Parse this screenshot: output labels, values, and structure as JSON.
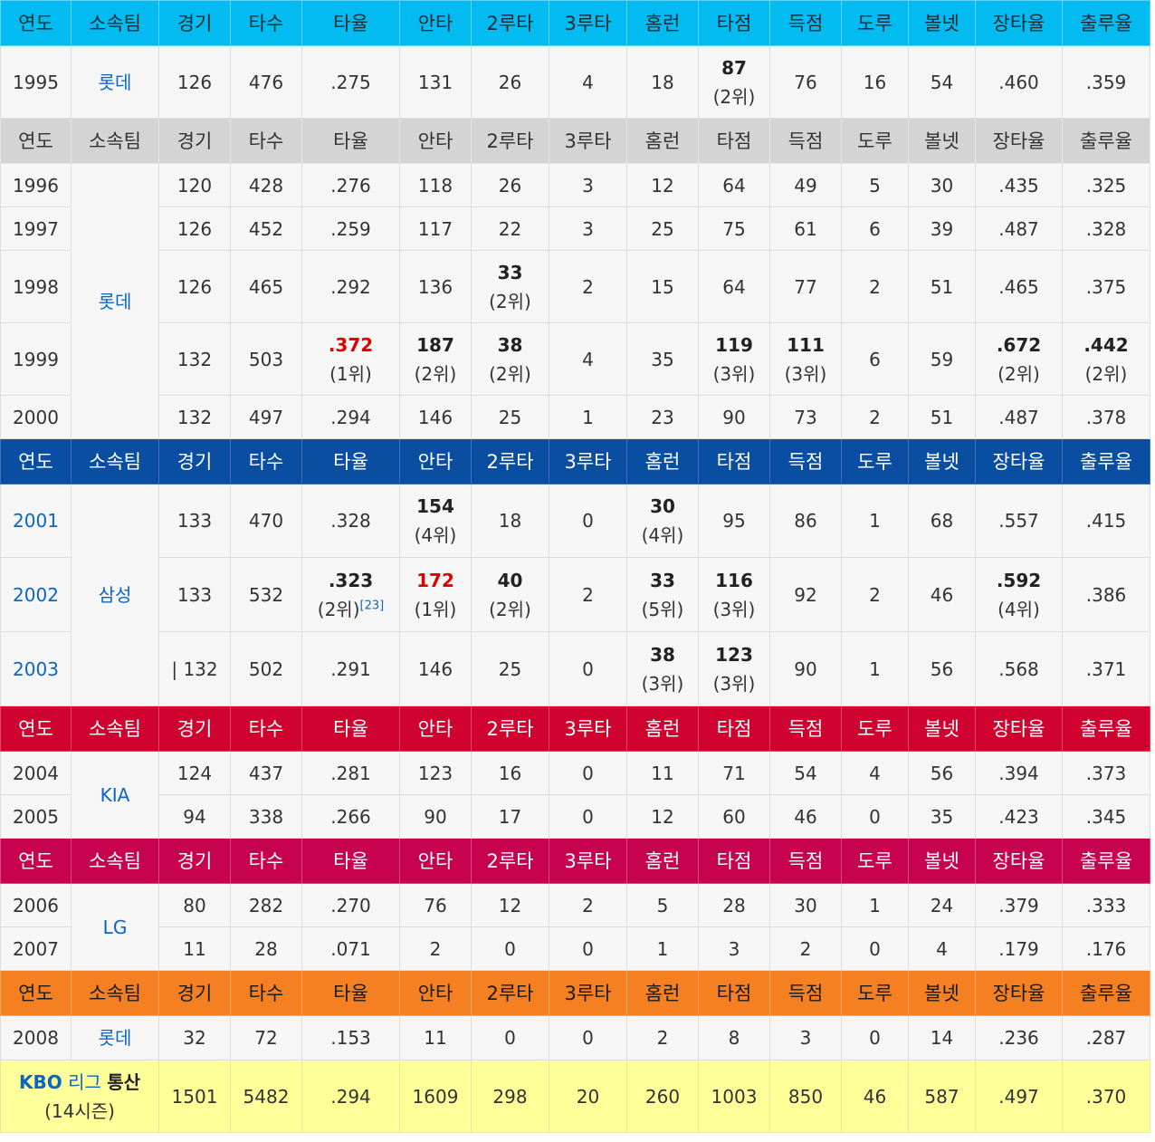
{
  "columns": [
    "연도",
    "소속팀",
    "경기",
    "타수",
    "타율",
    "안타",
    "2루타",
    "3루타",
    "홈런",
    "타점",
    "득점",
    "도루",
    "볼넷",
    "장타율",
    "출루율"
  ],
  "rank": {
    "r1": "(1위)",
    "r2": "(2위)",
    "r3": "(3위)",
    "r4": "(4위)",
    "r5": "(5위)"
  },
  "teams": {
    "lotte": "롯데",
    "samsung": "삼성",
    "kia": "KIA",
    "lg": "LG"
  },
  "header_colors": {
    "lotte_1995": "#02bbf1",
    "lotte_1996": "#d4d4d4",
    "samsung": "#0a4ea2",
    "kia": "#d0022f",
    "lg": "#c7024f",
    "lotte_2008": "#f48022",
    "total": "#ffff99",
    "league_leader": "#e00000"
  },
  "rows": {
    "y1995": {
      "year": "1995",
      "g": "126",
      "ab": "476",
      "avg": ".275",
      "h": "131",
      "d": "26",
      "t": "4",
      "hr": "18",
      "rbi": "87",
      "r": "76",
      "sb": "16",
      "bb": "54",
      "slg": ".460",
      "obp": ".359"
    },
    "y1996": {
      "year": "1996",
      "g": "120",
      "ab": "428",
      "avg": ".276",
      "h": "118",
      "d": "26",
      "t": "3",
      "hr": "12",
      "rbi": "64",
      "r": "49",
      "sb": "5",
      "bb": "30",
      "slg": ".435",
      "obp": ".325"
    },
    "y1997": {
      "year": "1997",
      "g": "126",
      "ab": "452",
      "avg": ".259",
      "h": "117",
      "d": "22",
      "t": "3",
      "hr": "25",
      "rbi": "75",
      "r": "61",
      "sb": "6",
      "bb": "39",
      "slg": ".487",
      "obp": ".328"
    },
    "y1998": {
      "year": "1998",
      "g": "126",
      "ab": "465",
      "avg": ".292",
      "h": "136",
      "d": "33",
      "t": "2",
      "hr": "15",
      "rbi": "64",
      "r": "77",
      "sb": "2",
      "bb": "51",
      "slg": ".465",
      "obp": ".375"
    },
    "y1999": {
      "year": "1999",
      "g": "132",
      "ab": "503",
      "avg": ".372",
      "h": "187",
      "d": "38",
      "t": "4",
      "hr": "35",
      "rbi": "119",
      "r": "111",
      "sb": "6",
      "bb": "59",
      "slg": ".672",
      "obp": ".442"
    },
    "y2000": {
      "year": "2000",
      "g": "132",
      "ab": "497",
      "avg": ".294",
      "h": "146",
      "d": "25",
      "t": "1",
      "hr": "23",
      "rbi": "90",
      "r": "73",
      "sb": "2",
      "bb": "51",
      "slg": ".487",
      "obp": ".378"
    },
    "y2001": {
      "year": "2001",
      "g": "133",
      "ab": "470",
      "avg": ".328",
      "h": "154",
      "d": "18",
      "t": "0",
      "hr": "30",
      "rbi": "95",
      "r": "86",
      "sb": "1",
      "bb": "68",
      "slg": ".557",
      "obp": ".415"
    },
    "y2002": {
      "year": "2002",
      "g": "133",
      "ab": "532",
      "avg": ".323",
      "avg_ref": "[23]",
      "h": "172",
      "d": "40",
      "t": "2",
      "hr": "33",
      "rbi": "116",
      "r": "92",
      "sb": "2",
      "bb": "46",
      "slg": ".592",
      "obp": ".386"
    },
    "y2003": {
      "year": "2003",
      "g": "| 132",
      "ab": "502",
      "avg": ".291",
      "h": "146",
      "d": "25",
      "t": "0",
      "hr": "38",
      "rbi": "123",
      "r": "90",
      "sb": "1",
      "bb": "56",
      "slg": ".568",
      "obp": ".371"
    },
    "y2004": {
      "year": "2004",
      "g": "124",
      "ab": "437",
      "avg": ".281",
      "h": "123",
      "d": "16",
      "t": "0",
      "hr": "11",
      "rbi": "71",
      "r": "54",
      "sb": "4",
      "bb": "56",
      "slg": ".394",
      "obp": ".373"
    },
    "y2005": {
      "year": "2005",
      "g": "94",
      "ab": "338",
      "avg": ".266",
      "h": "90",
      "d": "17",
      "t": "0",
      "hr": "12",
      "rbi": "60",
      "r": "46",
      "sb": "0",
      "bb": "35",
      "slg": ".423",
      "obp": ".345"
    },
    "y2006": {
      "year": "2006",
      "g": "80",
      "ab": "282",
      "avg": ".270",
      "h": "76",
      "d": "12",
      "t": "2",
      "hr": "5",
      "rbi": "28",
      "r": "30",
      "sb": "1",
      "bb": "24",
      "slg": ".379",
      "obp": ".333"
    },
    "y2007": {
      "year": "2007",
      "g": "11",
      "ab": "28",
      "avg": ".071",
      "h": "2",
      "d": "0",
      "t": "0",
      "hr": "1",
      "rbi": "3",
      "r": "2",
      "sb": "0",
      "bb": "4",
      "slg": ".179",
      "obp": ".176"
    },
    "y2008": {
      "year": "2008",
      "g": "32",
      "ab": "72",
      "avg": ".153",
      "h": "11",
      "d": "0",
      "t": "0",
      "hr": "2",
      "rbi": "8",
      "r": "3",
      "sb": "0",
      "bb": "14",
      "slg": ".236",
      "obp": ".287"
    }
  },
  "total": {
    "label_kbo": "KBO",
    "label_league": "리그",
    "label_total": "통산",
    "seasons": "(14시즌)",
    "g": "1501",
    "ab": "5482",
    "avg": ".294",
    "h": "1609",
    "d": "298",
    "t": "20",
    "hr": "260",
    "rbi": "1003",
    "r": "850",
    "sb": "46",
    "bb": "587",
    "slg": ".497",
    "obp": ".370"
  }
}
